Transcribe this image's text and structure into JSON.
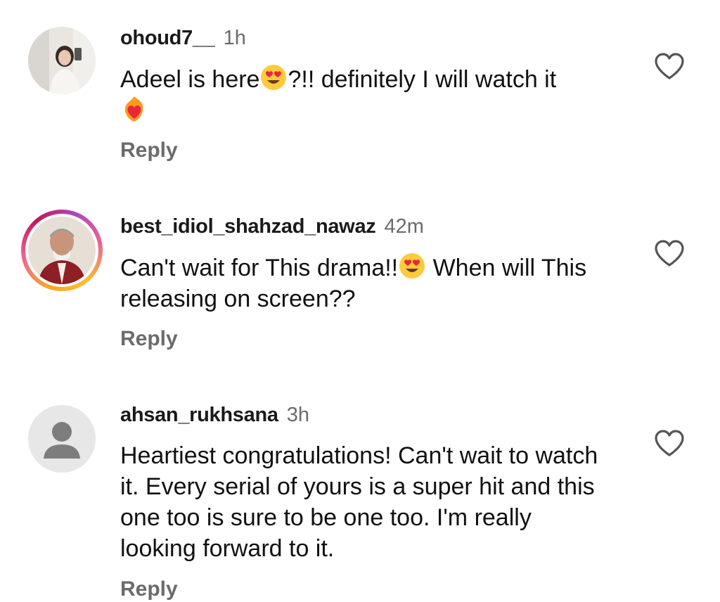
{
  "comments": [
    {
      "username": "ohoud7__",
      "time": "1h",
      "text_before_emoji": "Adeel is here",
      "emoji": "heart-eyes-emoji",
      "text_after_emoji": "?!! definitely I will watch it",
      "trailing_emoji": "heart-on-fire-emoji",
      "reply_label": "Reply"
    },
    {
      "username": "best_idiol_shahzad_nawaz",
      "time": "42m",
      "text_before_emoji": "Can't wait for This drama!!",
      "emoji": "heart-eyes-emoji",
      "text_after_emoji": " When will This releasing on screen??",
      "reply_label": "Reply"
    },
    {
      "username": "ahsan_rukhsana",
      "time": "3h",
      "text": "Heartiest congratulations! Can't wait to watch it. Every serial of yours is a super hit and this one too is sure to be one too. I'm really looking forward to it.",
      "reply_label": "Reply"
    }
  ],
  "icons": {
    "like": "heart-outline-icon",
    "default_avatar": "person-silhouette-icon"
  },
  "colors": {
    "text": "#111111",
    "secondary": "#6b6b6b",
    "story_ring_start": "#f9a825",
    "story_ring_end": "#c2185b"
  }
}
